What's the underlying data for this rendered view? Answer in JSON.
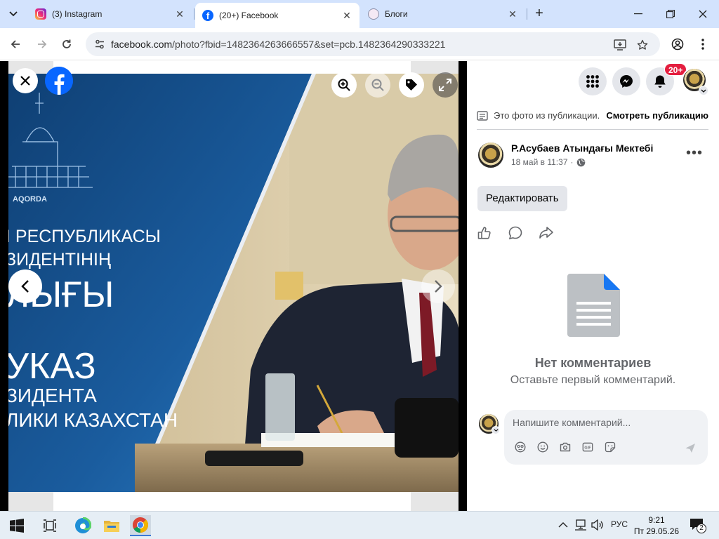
{
  "tabs": [
    {
      "title": "(3) Instagram",
      "active": false
    },
    {
      "title": "(20+) Facebook",
      "active": true
    },
    {
      "title": "Блоги",
      "active": false
    }
  ],
  "toolbar": {
    "url_domain": "facebook.com",
    "url_path": "/photo?fbid=1482364263666557&set=pcb.1482364290333221"
  },
  "photo": {
    "poster_lines": [
      "AQORDA",
      "І РЕСПУБЛИКАСЫ",
      "ЗИДЕНТІНІҢ",
      "ЛЫҒЫ",
      "УКАЗ",
      "ЗИДЕНТА",
      "ЛИКИ КАЗАХСТАН"
    ]
  },
  "header": {
    "notification_badge": "20+"
  },
  "post": {
    "from_post_text": "Это фото из публикации.",
    "see_post_label": "Смотреть публикацию",
    "page_name": "Р.Асубаев Атындағы Мектебі",
    "timestamp": "18 май в 11:37",
    "edit_label": "Редактировать"
  },
  "comments": {
    "empty_title": "Нет комментариев",
    "empty_subtitle": "Оставьте первый комментарий.",
    "input_placeholder": "Напишите комментарий..."
  },
  "taskbar": {
    "language": "РУС",
    "time": "9:21",
    "date": "Пт 29.05.26",
    "notifications_count": "2"
  },
  "colors": {
    "facebook_blue": "#0866ff",
    "tab_strip": "#d3e3fd",
    "badge_red": "#e41e3f",
    "poster_blue": "#1a5c9e"
  }
}
